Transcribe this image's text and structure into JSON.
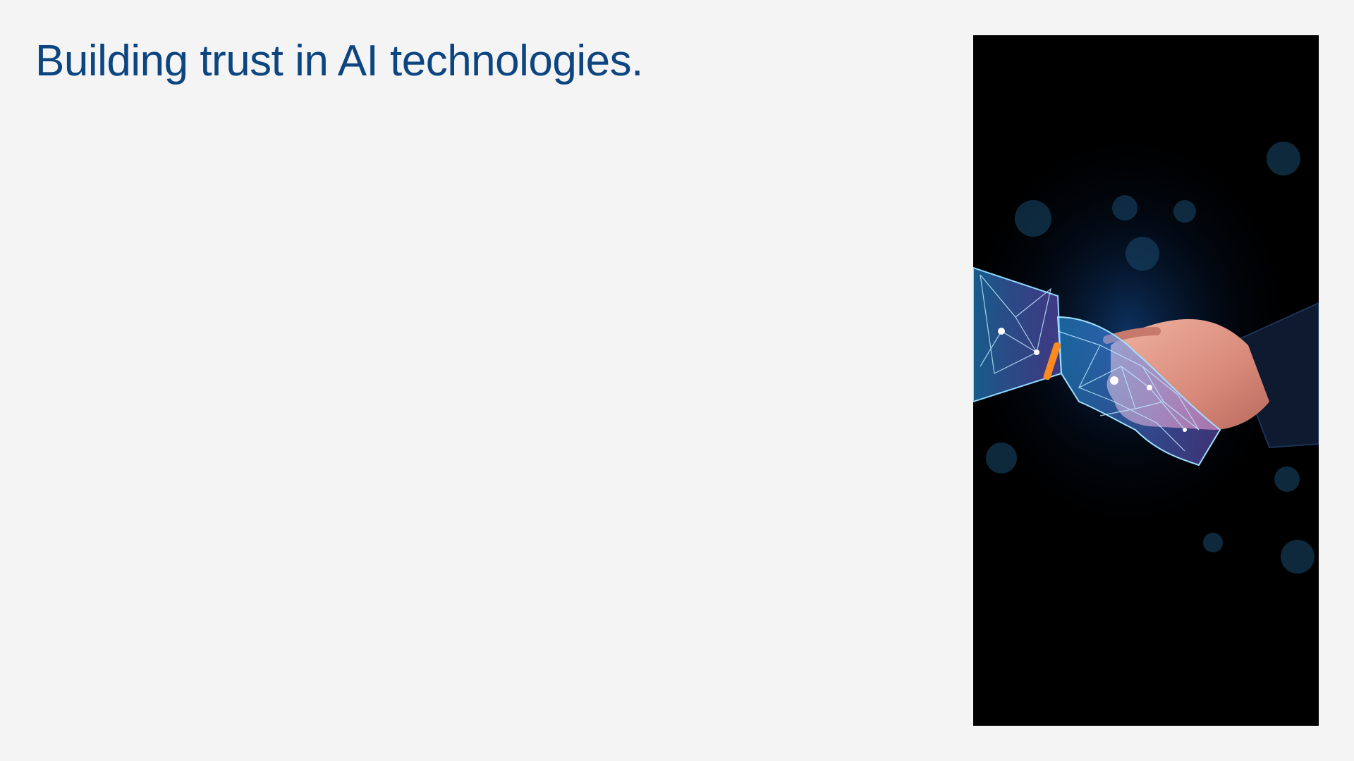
{
  "slide": {
    "title": "Building trust in AI technologies.",
    "image": {
      "subject": "robot-human-handshake",
      "background_color": "#000000",
      "robot_glow_color": "#3fb6ff",
      "accent_color": "#ff8a1e",
      "skin_color": "#e8a493"
    }
  },
  "colors": {
    "background": "#f4f4f4",
    "title": "#0c4580"
  }
}
